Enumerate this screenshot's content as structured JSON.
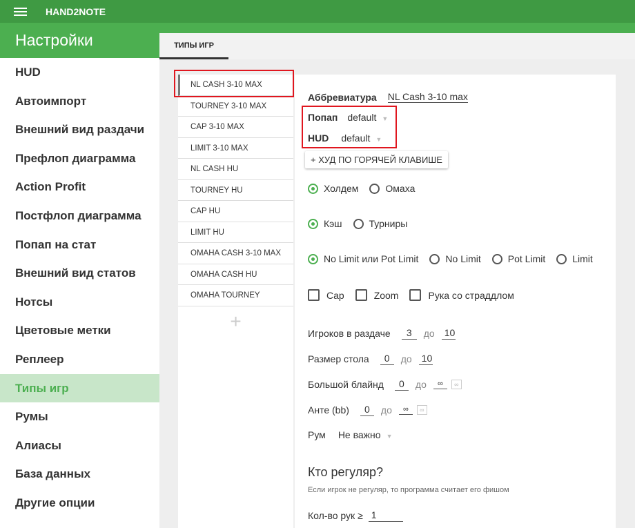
{
  "app": {
    "title": "HAND2NOTE"
  },
  "sidebar": {
    "header": "Настройки",
    "items": [
      {
        "label": "HUD"
      },
      {
        "label": "Автоимпорт"
      },
      {
        "label": "Внешний вид раздачи"
      },
      {
        "label": "Префлоп диаграмма"
      },
      {
        "label": "Action Profit"
      },
      {
        "label": "Постфлоп диаграмма"
      },
      {
        "label": "Попап на стат"
      },
      {
        "label": "Внешний вид статов"
      },
      {
        "label": "Нотсы"
      },
      {
        "label": "Цветовые метки"
      },
      {
        "label": "Реплеер"
      },
      {
        "label": "Типы игр",
        "active": true
      },
      {
        "label": "Румы"
      },
      {
        "label": "Алиасы"
      },
      {
        "label": "База данных"
      },
      {
        "label": "Другие опции"
      }
    ]
  },
  "tab": {
    "label": "ТИПЫ ИГР"
  },
  "game_types": [
    "NL CASH 3-10 MAX",
    "TOURNEY 3-10 MAX",
    "CAP 3-10 MAX",
    "LIMIT 3-10 MAX",
    "NL CASH HU",
    "TOURNEY HU",
    "CAP HU",
    "LIMIT HU",
    "OMAHA CASH 3-10 MAX",
    "OMAHA CASH HU",
    "OMAHA TOURNEY"
  ],
  "add_symbol": "+",
  "form": {
    "abbr_label": "Аббревиатура",
    "abbr_value": "NL Cash 3-10 max",
    "popup_label": "Попап",
    "popup_value": "default",
    "hud_label": "HUD",
    "hud_value": "default",
    "hotkey_button": "+ ХУД ПО ГОРЯЧЕЙ КЛАВИШЕ",
    "game": {
      "options": [
        "Холдем",
        "Омаха"
      ],
      "selected": "Холдем"
    },
    "format": {
      "options": [
        "Кэш",
        "Турниры"
      ],
      "selected": "Кэш"
    },
    "limit": {
      "options": [
        "No Limit или Pot Limit",
        "No Limit",
        "Pot Limit",
        "Limit"
      ],
      "selected": "No Limit или Pot Limit"
    },
    "checks": [
      {
        "label": "Cap",
        "checked": false
      },
      {
        "label": "Zoom",
        "checked": false
      },
      {
        "label": "Рука со страддлом",
        "checked": false
      }
    ],
    "to": "до",
    "players_label": "Игроков в раздаче",
    "players_from": "3",
    "players_to": "10",
    "table_label": "Размер стола",
    "table_from": "0",
    "table_to": "10",
    "bb_label": "Большой блайнд",
    "bb_from": "0",
    "bb_to": "∞",
    "ante_label": "Анте (bb)",
    "ante_from": "0",
    "ante_to": "∞",
    "inf_symbol": "∞",
    "room_label": "Рум",
    "room_value": "Не важно",
    "regular_title": "Кто регуляр?",
    "regular_hint": "Если игрок не регуляр, то программа считает его фишом",
    "hands_label": "Кол-во рук ≥",
    "hands_value": "1"
  },
  "colors": {
    "accent": "#4caf50",
    "highlight": "#e0161f",
    "active_bg": "#c8e6c9"
  }
}
